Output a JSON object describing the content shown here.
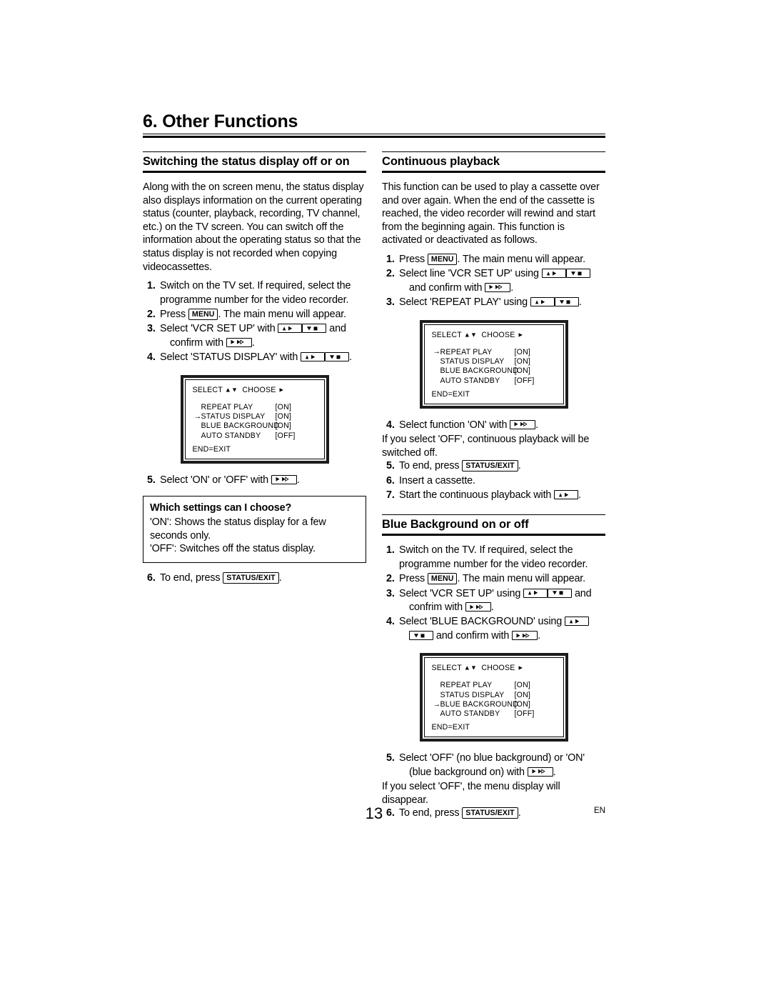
{
  "document": {
    "chapter_number_title": "6. Other Functions",
    "page_number": "13",
    "language_code": "EN"
  },
  "icons": {
    "menu_key": "MENU",
    "status_exit_key": "STATUS/EXIT",
    "up_right_key": "up-right-button",
    "down_stop_key": "down-stop-button",
    "play_ff_key": "play-fastforward-button"
  },
  "left_column": {
    "heading": "Switching the status display off or on",
    "intro": "Along with the on screen menu, the status display also displays information on the current operating status (counter, playback, recording, TV channel, etc.) on the TV screen. You can switch off the information about the operating status so that the status display is not recorded when copying videocassettes.",
    "steps": [
      {
        "num": "1.",
        "text_1": "Switch on the TV set. If required, select the programme number for the video recorder."
      },
      {
        "num": "2.",
        "text_1": "Press ",
        "key": "MENU",
        "text_2": ". The main menu will appear."
      },
      {
        "num": "3.",
        "text_1": "Select 'VCR SET UP' with ",
        "text_2": " and",
        "text_3": "confirm with ",
        "text_4": "."
      },
      {
        "num": "4.",
        "text_1": "Select 'STATUS DISPLAY' with ",
        "text_2": "."
      }
    ],
    "osd": {
      "header_select": "SELECT",
      "header_choose": "CHOOSE",
      "rows": [
        {
          "selected": false,
          "label": "REPEAT PLAY",
          "value": "[ON]"
        },
        {
          "selected": true,
          "label": "STATUS DISPLAY",
          "value": "[ON]"
        },
        {
          "selected": false,
          "label": "BLUE BACKGROUND",
          "value": "[ON]"
        },
        {
          "selected": false,
          "label": "AUTO STANDBY",
          "value": "[OFF]"
        }
      ],
      "end": "END=EXIT"
    },
    "step5": {
      "num": "5.",
      "text_1": "Select 'ON' or 'OFF' with ",
      "text_2": "."
    },
    "infobox": {
      "question": "Which settings can I choose?",
      "answer_on": "'ON': Shows the status display for a few seconds only.",
      "answer_off": "'OFF': Switches off the status display."
    },
    "step6": {
      "num": "6.",
      "text_1": "To end, press ",
      "key": "STATUS/EXIT",
      "text_2": "."
    }
  },
  "right_column": {
    "continuous": {
      "heading": "Continuous playback",
      "intro": "This function can be used to play a cassette over and over again. When the end of the cassette is reached, the video recorder will rewind and start from the beginning again. This function is activated or deactivated as follows.",
      "steps": [
        {
          "num": "1.",
          "text_1": "Press ",
          "key": "MENU",
          "text_2": ". The main menu will appear."
        },
        {
          "num": "2.",
          "text_1": "Select line 'VCR SET UP' using ",
          "text_2": "",
          "text_3": "and confirm with ",
          "text_4": "."
        },
        {
          "num": "3.",
          "text_1": "Select 'REPEAT PLAY' using ",
          "text_2": "."
        }
      ],
      "osd": {
        "header_select": "SELECT",
        "header_choose": "CHOOSE",
        "rows": [
          {
            "selected": true,
            "label": "REPEAT PLAY",
            "value": "[ON]"
          },
          {
            "selected": false,
            "label": "STATUS DISPLAY",
            "value": "[ON]"
          },
          {
            "selected": false,
            "label": "BLUE BACKGROUND",
            "value": "[ON]"
          },
          {
            "selected": false,
            "label": "AUTO STANDBY",
            "value": "[OFF]"
          }
        ],
        "end": "END=EXIT"
      },
      "step4": {
        "num": "4.",
        "text_1": "Select function 'ON' with ",
        "text_2": "."
      },
      "note": "If you select 'OFF', continuous playback will be switched off.",
      "step5": {
        "num": "5.",
        "text_1": "To end, press ",
        "key": "STATUS/EXIT",
        "text_2": "."
      },
      "step6": {
        "num": "6.",
        "text_1": "Insert a cassette."
      },
      "step7": {
        "num": "7.",
        "text_1": "Start the continuous playback with ",
        "text_2": "."
      }
    },
    "blue_background": {
      "heading": "Blue Background on or off",
      "steps": [
        {
          "num": "1.",
          "text_1": "Switch on the TV. If required, select the programme number for the video recorder."
        },
        {
          "num": "2.",
          "text_1": "Press ",
          "key": "MENU",
          "text_2": ". The main menu will appear."
        },
        {
          "num": "3.",
          "text_1": "Select 'VCR SET UP' using ",
          "text_2": " and",
          "text_3": "confrim with ",
          "text_4": "."
        },
        {
          "num": "4.",
          "text_1": "Select 'BLUE BACKGROUND' using ",
          "text_2": "",
          "text_3": " and confirm with ",
          "text_4": "."
        }
      ],
      "osd": {
        "header_select": "SELECT",
        "header_choose": "CHOOSE",
        "rows": [
          {
            "selected": false,
            "label": "REPEAT PLAY",
            "value": "[ON]"
          },
          {
            "selected": false,
            "label": "STATUS DISPLAY",
            "value": "[ON]"
          },
          {
            "selected": true,
            "label": "BLUE BACKGROUND",
            "value": "[ON]"
          },
          {
            "selected": false,
            "label": "AUTO STANDBY",
            "value": "[OFF]"
          }
        ],
        "end": "END=EXIT"
      },
      "step5": {
        "num": "5.",
        "text_1": "Select 'OFF' (no blue background) or 'ON'",
        "text_2": "(blue background on) with ",
        "text_3": "."
      },
      "note": "If you select 'OFF', the menu display will disappear.",
      "step6": {
        "num": "6.",
        "text_1": "To end, press ",
        "key": "STATUS/EXIT",
        "text_2": "."
      }
    }
  }
}
